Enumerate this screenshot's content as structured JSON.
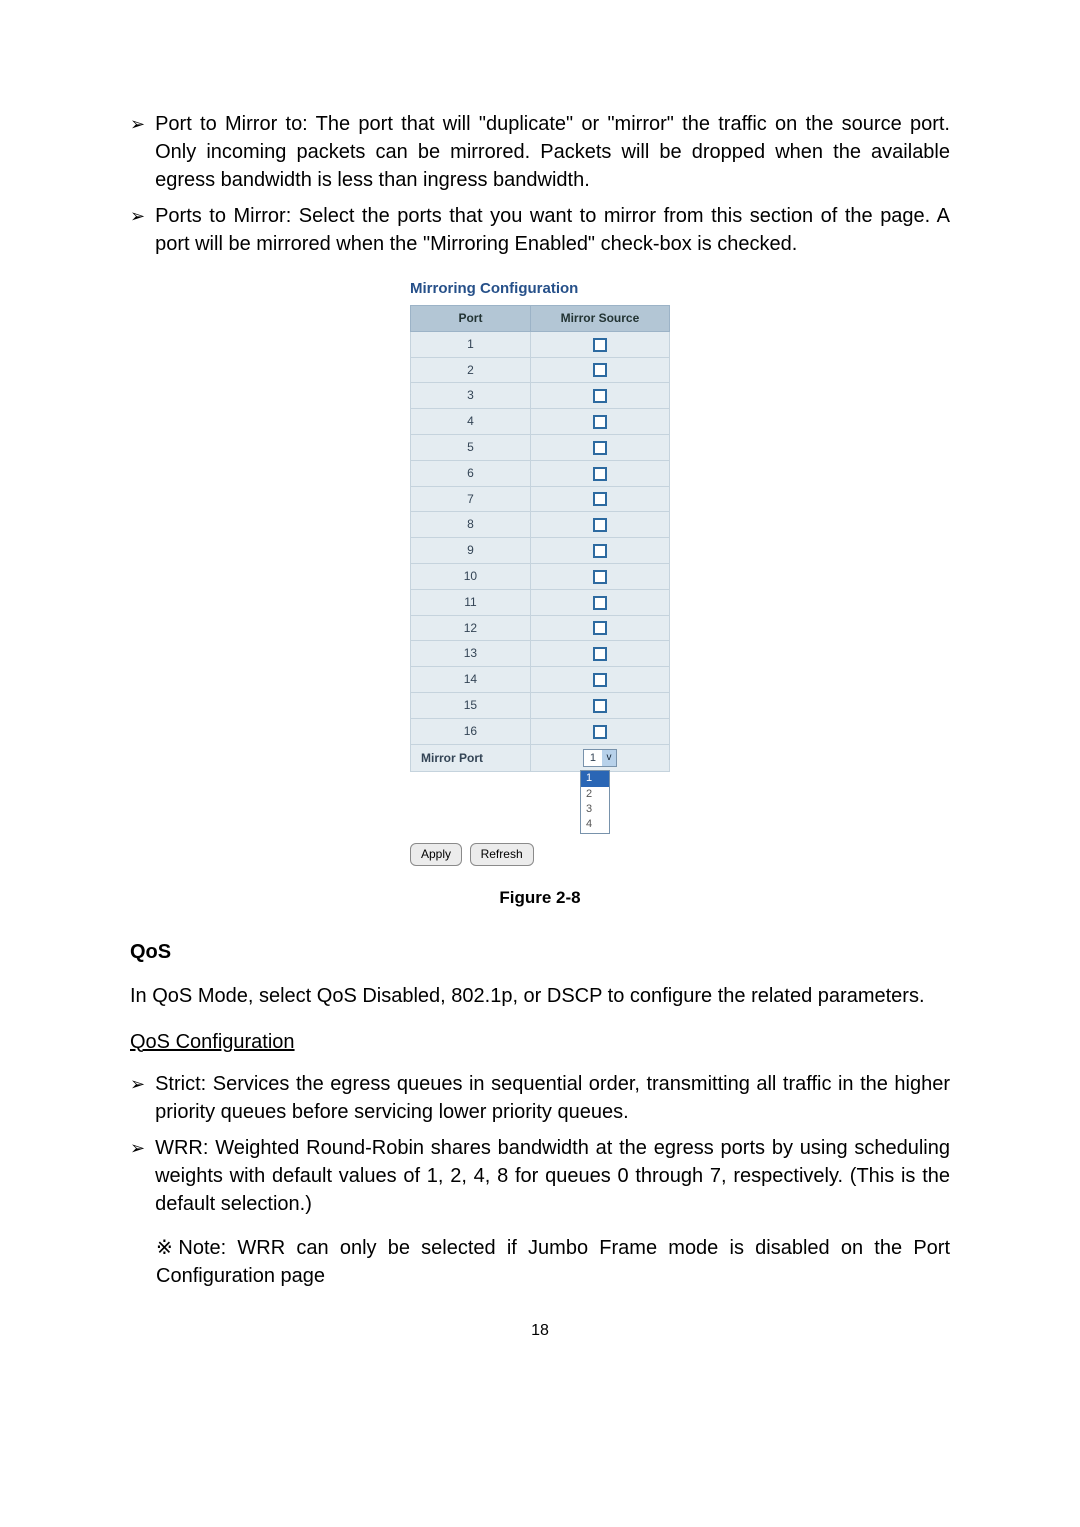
{
  "bullets": {
    "b1_label": "Port to Mirror to: The port that will \"duplicate\" or \"mirror\" the traffic on the source port. Only incoming packets can be mirrored. Packets will be dropped when the available egress bandwidth is less than ingress bandwidth.",
    "b2_label": "Ports to Mirror: Select the ports that you want to mirror from this section of the page. A port will be mirrored when the \"Mirroring Enabled\" check-box is checked."
  },
  "config": {
    "title": "Mirroring Configuration",
    "headers": {
      "port": "Port",
      "source": "Mirror Source"
    },
    "rows": [
      "1",
      "2",
      "3",
      "4",
      "5",
      "6",
      "7",
      "8",
      "9",
      "10",
      "11",
      "12",
      "13",
      "14",
      "15",
      "16"
    ],
    "mirror_port_label": "Mirror Port",
    "select_value": "1",
    "options": [
      "1",
      "2",
      "3",
      "4"
    ],
    "apply": "Apply",
    "refresh": "Refresh"
  },
  "figure_label": "Figure 2-8",
  "qos_heading": "QoS",
  "qos_intro": "In QoS Mode, select QoS Disabled, 802.1p, or DSCP to configure the related parameters.",
  "qos_config_heading": "QoS Configuration",
  "qos": {
    "strict": "Strict: Services the egress queues in sequential order, transmitting all traffic in the higher priority queues before servicing lower priority queues.",
    "wrr": "WRR: Weighted Round-Robin shares bandwidth at the egress ports by using scheduling weights with default values of 1, 2, 4, 8 for queues 0 through 7, respectively. (This is the default selection.)",
    "note": "※Note: WRR can only be selected if Jumbo Frame mode is disabled on the Port Configuration page"
  },
  "page_number": "18",
  "arrow": "➢"
}
